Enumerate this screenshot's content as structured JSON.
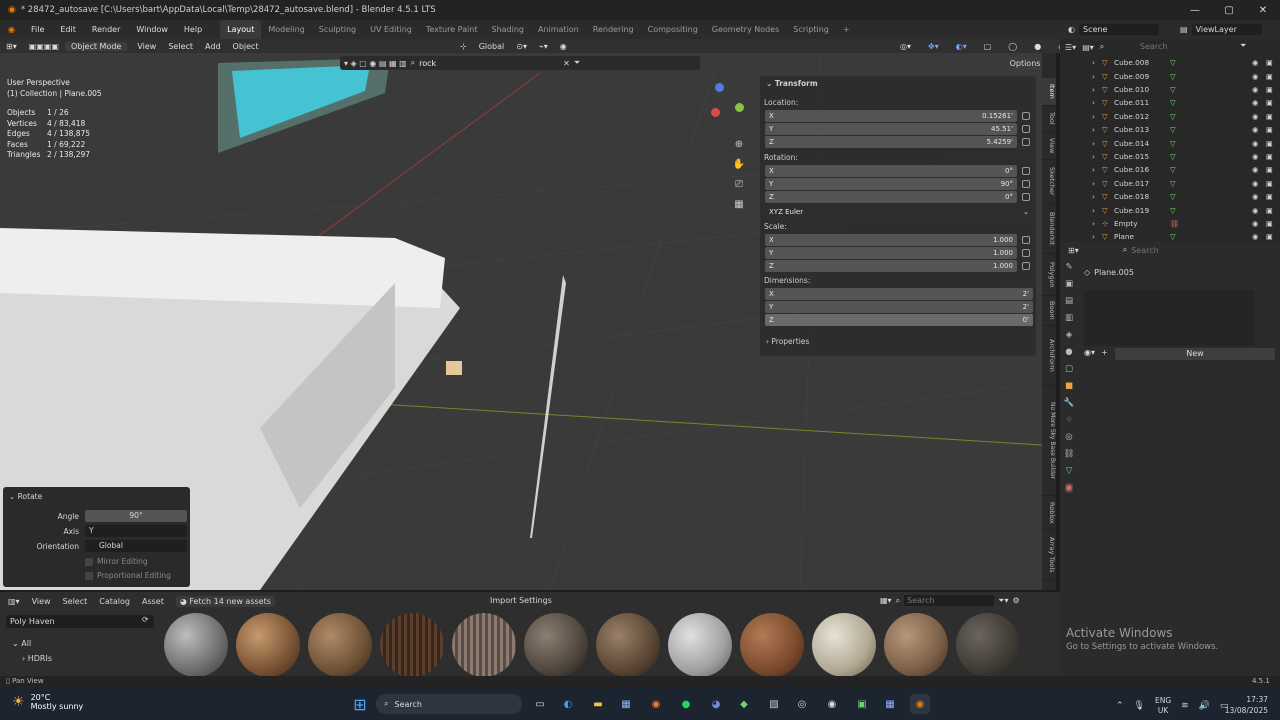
{
  "window": {
    "title": "* 28472_autosave [C:\\Users\\bart\\AppData\\Local\\Temp\\28472_autosave.blend] - Blender 4.5.1 LTS",
    "min": "—",
    "max": "▢",
    "close": "✕"
  },
  "menu": {
    "items": [
      "File",
      "Edit",
      "Render",
      "Window",
      "Help"
    ],
    "workspaces": [
      "Layout",
      "Modeling",
      "Sculpting",
      "UV Editing",
      "Texture Paint",
      "Shading",
      "Animation",
      "Rendering",
      "Compositing",
      "Geometry Nodes",
      "Scripting"
    ],
    "add": "+",
    "scene": "Scene",
    "view_layer": "ViewLayer"
  },
  "header": {
    "mode": "Object Mode",
    "view": "View",
    "select": "Select",
    "add": "Add",
    "object": "Object",
    "orientation": "Global",
    "search_value": "rock",
    "options": "Options"
  },
  "overlay": {
    "perspective": "User Perspective",
    "collection": "(1) Collection | Plane.005",
    "stats": [
      {
        "k": "Objects",
        "v": "1 / 26"
      },
      {
        "k": "Vertices",
        "v": "4 / 83,418"
      },
      {
        "k": "Edges",
        "v": "4 / 138,875"
      },
      {
        "k": "Faces",
        "v": "1 / 69,222"
      },
      {
        "k": "Triangles",
        "v": "2 / 138,297"
      }
    ]
  },
  "transform": {
    "title": "Transform",
    "location_label": "Location:",
    "location": [
      {
        "a": "X",
        "v": "0.15261'"
      },
      {
        "a": "Y",
        "v": "45.51'"
      },
      {
        "a": "Z",
        "v": "5.4259'"
      }
    ],
    "rotation_label": "Rotation:",
    "rotation": [
      {
        "a": "X",
        "v": "0°"
      },
      {
        "a": "Y",
        "v": "90°"
      },
      {
        "a": "Z",
        "v": "0°"
      }
    ],
    "euler": "XYZ Euler",
    "scale_label": "Scale:",
    "scale": [
      {
        "a": "X",
        "v": "1.000"
      },
      {
        "a": "Y",
        "v": "1.000"
      },
      {
        "a": "Z",
        "v": "1.000"
      }
    ],
    "dimensions_label": "Dimensions:",
    "dimensions": [
      {
        "a": "X",
        "v": "2'"
      },
      {
        "a": "Y",
        "v": "2'"
      },
      {
        "a": "Z",
        "v": "0'"
      }
    ],
    "properties": "Properties"
  },
  "side_tabs": [
    "Item",
    "Tool",
    "View",
    "Sketcher",
    "Blenderkit",
    "Polygon",
    "Boom",
    "ArchiForm",
    "No More Sky Base Builder",
    "Roblox",
    "Array Tools"
  ],
  "redo_panel": {
    "title": "Rotate",
    "angle_label": "Angle",
    "angle": "90°",
    "axis_label": "Axis",
    "axis": "Y",
    "orientation_label": "Orientation",
    "orientation": "Global",
    "mirror": "Mirror Editing",
    "proportional": "Proportional Editing"
  },
  "outliner": {
    "search_placeholder": "Search",
    "items": [
      "Cube.008",
      "Cube.009",
      "Cube.010",
      "Cube.011",
      "Cube.012",
      "Cube.013",
      "Cube.014",
      "Cube.015",
      "Cube.016",
      "Cube.017",
      "Cube.018",
      "Cube.019",
      "Empty",
      "Plane"
    ]
  },
  "properties": {
    "search_placeholder": "Search",
    "object": "Plane.005",
    "new_label": "New"
  },
  "asset_browser": {
    "view": "View",
    "select": "Select",
    "catalog": "Catalog",
    "asset": "Asset",
    "fetch": "Fetch 14 new assets",
    "import": "Import Settings",
    "search_placeholder": "Search",
    "library": "Poly Haven",
    "tree": [
      "All",
      "HDRIs"
    ]
  },
  "status": {
    "left": "Pan View",
    "version": "4.5.1"
  },
  "watermark": {
    "title": "Activate Windows",
    "subtitle": "Go to Settings to activate Windows."
  },
  "taskbar": {
    "weather_temp": "20°C",
    "weather_desc": "Mostly sunny",
    "search": "Search",
    "lang": "ENG",
    "region": "UK",
    "time": "17:37",
    "date": "13/08/2025"
  }
}
